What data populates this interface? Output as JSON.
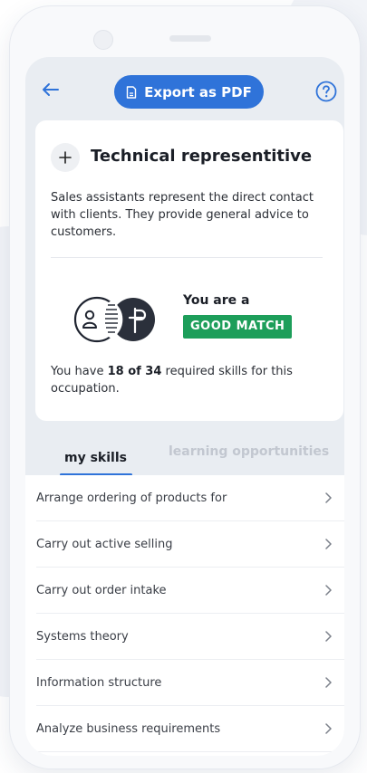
{
  "header": {
    "export_label": "Export as PDF"
  },
  "occupation": {
    "title": "Technical representitive",
    "description": "Sales assistants represent the direct contact with clients. They provide general advice to customers.",
    "you_are_label": "You are a",
    "match_label": "GOOD MATCH",
    "skills_prefix": "You have ",
    "skills_count": "18 of 34",
    "skills_suffix": " required skills for this occupation."
  },
  "tabs": [
    {
      "label": "my skills",
      "active": true
    },
    {
      "label": "learning opportunities",
      "active": false
    }
  ],
  "skills": [
    {
      "label": "Arrange ordering of products for"
    },
    {
      "label": "Carry out active selling"
    },
    {
      "label": "Carry out order intake"
    },
    {
      "label": "Systems theory"
    },
    {
      "label": "Information structure"
    },
    {
      "label": "Analyze business requirements"
    }
  ],
  "colors": {
    "accent": "#2f73d9",
    "match_green": "#1d9e5a",
    "screen_bg": "#e9edf2"
  },
  "icons": {
    "back": "arrow-left-icon",
    "export": "document-icon",
    "help": "question-circle-icon",
    "add": "plus-icon",
    "match": "person-match-icon",
    "chevron": "chevron-right-icon"
  }
}
